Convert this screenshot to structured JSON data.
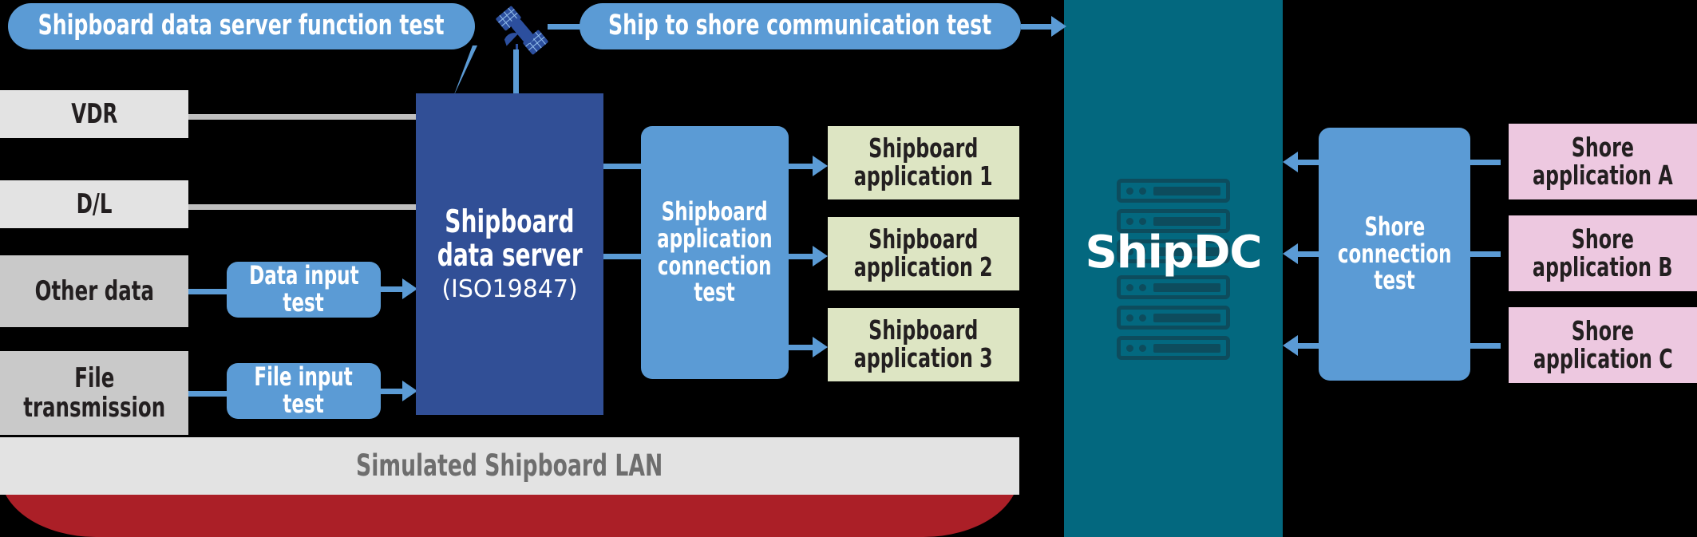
{
  "diagram": {
    "callouts": {
      "server_function_test": "Shipboard data server function test",
      "ship_to_shore": "Ship to shore communication test"
    },
    "sources": [
      {
        "label": "VDR",
        "tone": "light"
      },
      {
        "label": "D/L",
        "tone": "light"
      },
      {
        "label": "Other data",
        "tone": "dark"
      },
      {
        "label": "File\ntransmission",
        "tone": "dark"
      }
    ],
    "input_tests": [
      {
        "line1": "Data input",
        "line2": "test"
      },
      {
        "line1": "File input",
        "line2": "test"
      }
    ],
    "server": {
      "line1": "Shipboard",
      "line2": "data server",
      "standard": "(ISO19847)"
    },
    "app_connection_test": {
      "line1": "Shipboard",
      "line2": "application",
      "line3": "connection",
      "line4": "test"
    },
    "shipboard_apps": [
      {
        "line1": "Shipboard",
        "line2": "application 1"
      },
      {
        "line1": "Shipboard",
        "line2": "application 2"
      },
      {
        "line1": "Shipboard",
        "line2": "application 3"
      }
    ],
    "shipdc": {
      "label": "ShipDC",
      "icon": "server-rack-icon",
      "rack_units": 6
    },
    "shore_connection_test": {
      "line1": "Shore",
      "line2": "connection",
      "line3": "test"
    },
    "shore_apps": [
      {
        "line1": "Shore",
        "line2": "application A"
      },
      {
        "line1": "Shore",
        "line2": "application B"
      },
      {
        "line1": "Shore",
        "line2": "application C"
      }
    ],
    "lan_bar": "Simulated Shipboard LAN",
    "satellite_icon": "satellite-icon",
    "colors": {
      "accent_blue": "#5b9bd5",
      "navy": "#314f96",
      "teal": "#03687f",
      "teal_dark": "#0d4c5d",
      "hull_red": "#ab1f27",
      "gray_light": "#e3e3e3",
      "gray_dark": "#c9c9c9",
      "green": "#dde5c3",
      "pink": "#edc8e0",
      "connector_gray": "#bfbfbf",
      "background": "#000000",
      "text_dark": "#231f20",
      "lan_text": "#6e6e6e"
    }
  }
}
